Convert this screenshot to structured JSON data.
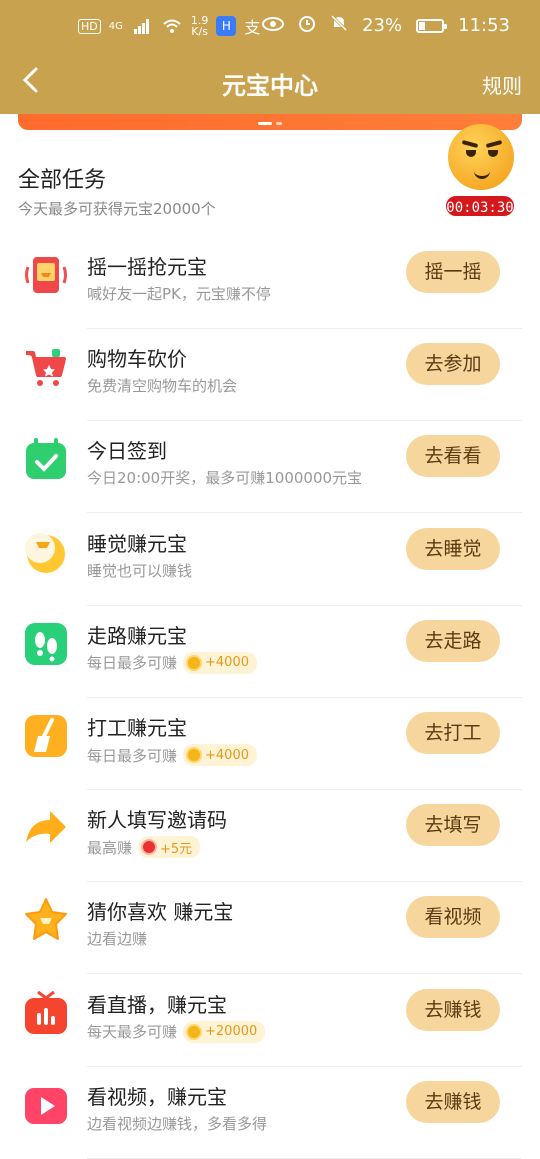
{
  "status_bar": {
    "hd": "HD",
    "network": "4G",
    "speed_value": "1.9",
    "speed_unit": "K/s",
    "battery": "23%",
    "time": "11:53"
  },
  "topbar": {
    "title": "元宝中心",
    "rules": "规则"
  },
  "tasks_header": {
    "title": "全部任务",
    "subtitle": "今天最多可获得元宝20000个"
  },
  "timer": "00:03:30",
  "tasks": [
    {
      "name": "摇一摇抢元宝",
      "desc": "喊好友一起PK，元宝赚不停",
      "button": "摇一摇",
      "icon": "shake-phone-icon"
    },
    {
      "name": "购物车砍价",
      "desc": "免费清空购物车的机会",
      "button": "去参加",
      "icon": "cart-icon"
    },
    {
      "name": "今日签到",
      "desc": "今日20:00开奖，最多可赚1000000元宝",
      "button": "去看看",
      "icon": "calendar-check-icon"
    },
    {
      "name": "睡觉赚元宝",
      "desc": "睡觉也可以赚钱",
      "button": "去睡觉",
      "icon": "moon-icon"
    },
    {
      "name": "走路赚元宝",
      "desc": "每日最多可赚",
      "reward": "+4000",
      "button": "去走路",
      "icon": "footprints-icon"
    },
    {
      "name": "打工赚元宝",
      "desc": "每日最多可赚",
      "reward": "+4000",
      "button": "去打工",
      "icon": "broom-icon"
    },
    {
      "name": "新人填写邀请码",
      "desc": "最高赚",
      "reward": "+5元",
      "button": "去填写",
      "icon": "share-arrow-icon"
    },
    {
      "name": "猜你喜欢 赚元宝",
      "desc": "边看边赚",
      "button": "看视频",
      "icon": "star-icon"
    },
    {
      "name": "看直播，赚元宝",
      "desc": "每天最多可赚",
      "reward": "+20000",
      "button": "去赚钱",
      "icon": "live-tv-icon"
    },
    {
      "name": "看视频，赚元宝",
      "desc": "边看视频边赚钱，多看多得",
      "button": "去赚钱",
      "icon": "video-play-icon"
    }
  ]
}
